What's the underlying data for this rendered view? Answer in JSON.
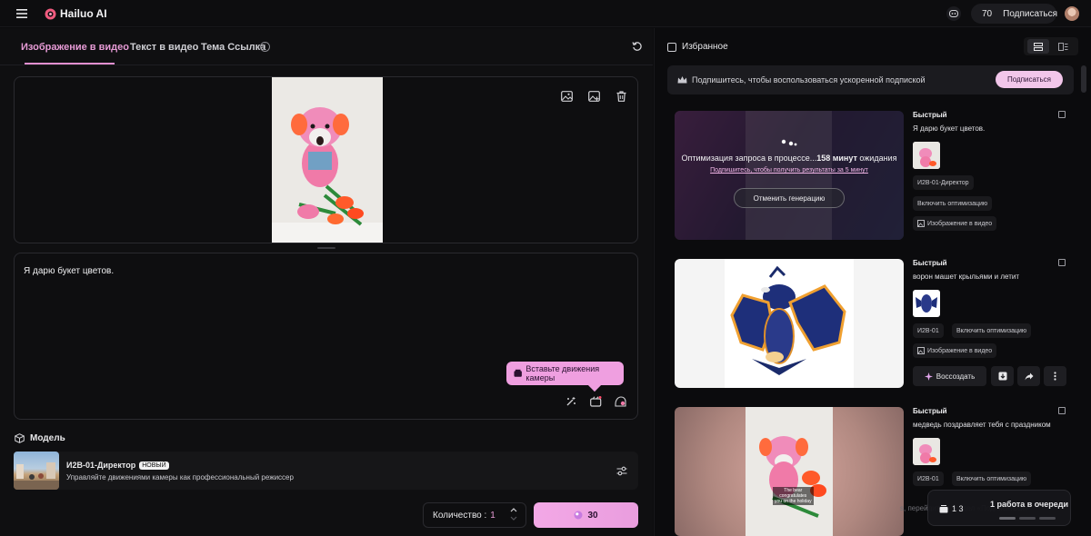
{
  "app": {
    "name": "Hailuo AI"
  },
  "header": {
    "credits": "70",
    "subscribe_label": "Подписаться"
  },
  "tabs": [
    {
      "label": "Изображение в видео",
      "active": true
    },
    {
      "label": "Текст в видео",
      "active": false
    },
    {
      "label": "Тема Ссылка",
      "active": false
    }
  ],
  "prompt": {
    "text": "Я дарю букет цветов.",
    "camera_tip": "Вставьте движения камеры"
  },
  "model": {
    "section_label": "Модель",
    "name": "И2В-01-Директор",
    "badge": "НОВЫЙ",
    "description": "Управляйте движениями камеры как профессиональный режиссер"
  },
  "quantity": {
    "label": "Количество :",
    "value": "1"
  },
  "generate": {
    "cost": "30"
  },
  "right": {
    "favorites_label": "Избранное",
    "banner": {
      "text": "Подпишитесь, чтобы воспользоваться ускоренной подпиской",
      "button": "Подписаться"
    },
    "cards": [
      {
        "mode": "Быстрый",
        "prompt": "Я дарю букет цветов.",
        "model": "И2В-01-Директор",
        "optimize": "Включить оптимизацию",
        "type": "Изображение в видео",
        "status_text_a": "Оптимизация запроса в процессе...",
        "status_minutes": "158 минут",
        "status_text_b": " ожидания",
        "status_sub": "Подпишитесь, чтобы получить результаты за 5 минут",
        "cancel": "Отменить генерацию"
      },
      {
        "mode": "Быстрый",
        "prompt": "ворон машет крыльями и летит",
        "model": "И2В-01",
        "optimize": "Включить оптимизацию",
        "type": "Изображение в видео",
        "recreate": "Воссоздать"
      },
      {
        "mode": "Быстрый",
        "prompt": "медведь поздравляет тебя с праздником",
        "model": "И2В-01",
        "optimize": "Включить оптимизацию",
        "overlay_caption_1": "The bear",
        "overlay_caption_2": "congratulates",
        "overlay_caption_3": "you on the holiday"
      }
    ],
    "queue": {
      "count": "1 3",
      "text": "1 работа в очереди"
    },
    "behind_text": "s, перейдите в раздел «Подписаться»"
  },
  "colors": {
    "accent": "#e79bd6",
    "accent_button": "#f3a8e6",
    "background": "#0b0b0d"
  }
}
